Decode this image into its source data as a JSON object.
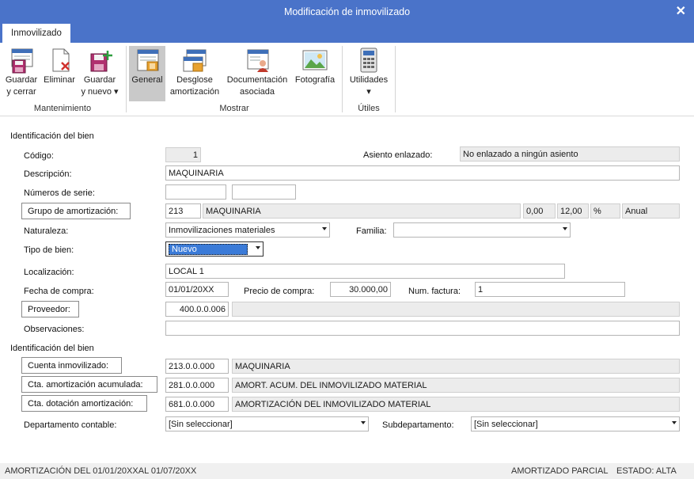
{
  "window": {
    "title": "Modificación de inmovilizado",
    "close_glyph": "✕"
  },
  "tabs": [
    {
      "label": "Inmovilizado"
    }
  ],
  "ribbon": {
    "buttons": [
      {
        "line1": "Guardar",
        "line2": "y cerrar",
        "icon": "save-close-icon"
      },
      {
        "line1": "Eliminar",
        "line2": "",
        "icon": "delete-icon"
      },
      {
        "line1": "Guardar",
        "line2": "y nuevo ▾",
        "icon": "save-new-icon"
      },
      {
        "line1": "General",
        "line2": "",
        "icon": "general-icon"
      },
      {
        "line1": "Desglose",
        "line2": "amortización",
        "icon": "breakdown-icon"
      },
      {
        "line1": "Documentación",
        "line2": "asociada",
        "icon": "documentation-icon"
      },
      {
        "line1": "Fotografía",
        "line2": "",
        "icon": "photo-icon"
      },
      {
        "line1": "Utilidades",
        "line2": "▾",
        "icon": "calculator-icon"
      }
    ],
    "groups": [
      "Mantenimiento",
      "Mostrar",
      "Útiles"
    ]
  },
  "form": {
    "section1": "Identificación del bien",
    "section2": "Identificación del bien",
    "codigo": {
      "label": "Código:",
      "value": "1"
    },
    "asiento": {
      "label": "Asiento enlazado:",
      "value": "No enlazado a ningún asiento"
    },
    "descripcion": {
      "label": "Descripción:",
      "value": "MAQUINARIA"
    },
    "numeros_serie": {
      "label": "Números de serie:",
      "value1": "",
      "value2": ""
    },
    "grupo": {
      "label": "Grupo de amortización:",
      "code": "213",
      "name": "MAQUINARIA",
      "v1": "0,00",
      "v2": "12,00",
      "pct": "%",
      "period": "Anual"
    },
    "naturaleza": {
      "label": "Naturaleza:",
      "value": "Inmovilizaciones materiales"
    },
    "familia": {
      "label": "Familia:",
      "value": ""
    },
    "tipo_bien": {
      "label": "Tipo de bien:",
      "value": "Nuevo"
    },
    "localizacion": {
      "label": "Localización:",
      "value": "LOCAL 1"
    },
    "fecha_compra": {
      "label": "Fecha de compra:",
      "value": "01/01/20XX"
    },
    "precio_compra": {
      "label": "Precio de compra:",
      "value": "30.000,00"
    },
    "num_factura": {
      "label": "Num. factura:",
      "value": "1"
    },
    "proveedor": {
      "label": "Proveedor:",
      "code": "400.0.0.006",
      "name": ""
    },
    "observaciones": {
      "label": "Observaciones:",
      "value": ""
    },
    "cuenta_inmov": {
      "label": "Cuenta inmovilizado:",
      "code": "213.0.0.000",
      "name": "MAQUINARIA"
    },
    "cta_amort": {
      "label": "Cta. amortización acumulada:",
      "code": "281.0.0.000",
      "name": "AMORT. ACUM. DEL INMOVILIZADO MATERIAL"
    },
    "cta_dotacion": {
      "label": "Cta. dotación amortización:",
      "code": "681.0.0.000",
      "name": "AMORTIZACIÓN DEL INMOVILIZADO MATERIAL"
    },
    "departamento": {
      "label": "Departamento contable:",
      "value": "[Sin seleccionar]"
    },
    "subdepartamento": {
      "label": "Subdepartamento:",
      "value": "[Sin seleccionar]"
    }
  },
  "status": {
    "left": "AMORTIZACIÓN DEL 01/01/20XXAL 01/07/20XX",
    "middle": "AMORTIZADO PARCIAL",
    "right": "ESTADO: ALTA"
  },
  "colors": {
    "titlebar": "#4a73c9",
    "selection": "#3b7bd8",
    "active_button": "#c9c9c9"
  }
}
